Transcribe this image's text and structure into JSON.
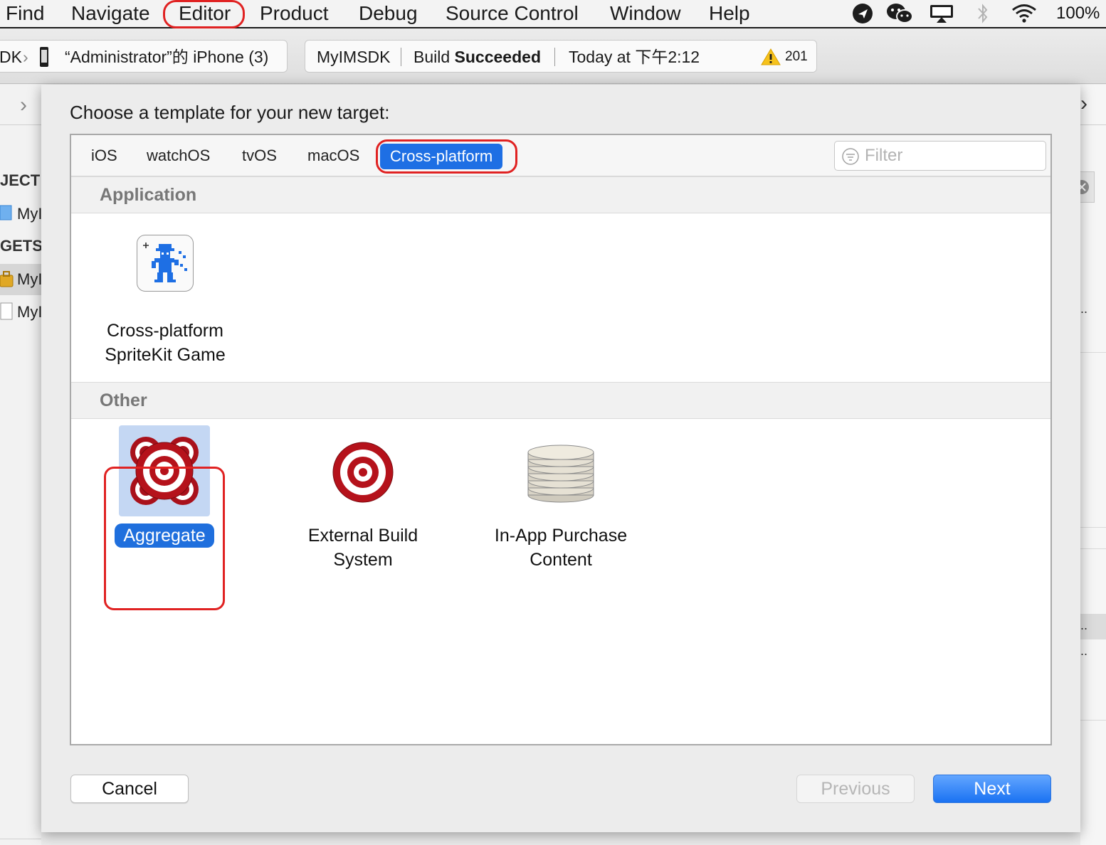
{
  "menubar": {
    "items": [
      "Find",
      "Navigate",
      "Editor",
      "Product",
      "Debug",
      "Source Control",
      "Window",
      "Help"
    ],
    "highlighted": "Editor",
    "status_icons": [
      "lark-icon",
      "wechat-icon",
      "airplay-icon",
      "bluetooth-icon",
      "wifi-icon"
    ],
    "battery": "100%"
  },
  "toolbar": {
    "scheme_left": "DK",
    "device": "“Administrator”的 iPhone (3)",
    "project": "MyIMSDK",
    "build_prefix": "Build ",
    "build_status": "Succeeded",
    "time": "Today at 下午2:12",
    "warnings": "201"
  },
  "navigator": {
    "project_header": "JECT",
    "project_item": "MyI",
    "targets_header": "GETS",
    "target_items": [
      "MyI",
      "MyI"
    ]
  },
  "dialog": {
    "title": "Choose a template for your new target:",
    "tabs": [
      "iOS",
      "watchOS",
      "tvOS",
      "macOS",
      "Cross-platform"
    ],
    "active_tab": "Cross-platform",
    "filter_placeholder": "Filter",
    "sections": [
      {
        "title": "Application",
        "templates": [
          {
            "line1": "Cross-platform",
            "line2": "SpriteKit Game",
            "icon": "spritekit-game-icon"
          }
        ]
      },
      {
        "title": "Other",
        "templates": [
          {
            "line1": "Aggregate",
            "line2": "",
            "icon": "aggregate-icon",
            "selected": true
          },
          {
            "line1": "External Build",
            "line2": "System",
            "icon": "external-build-icon"
          },
          {
            "line1": "In-App Purchase",
            "line2": "Content",
            "icon": "coins-icon"
          }
        ]
      }
    ],
    "buttons": {
      "cancel": "Cancel",
      "previous": "Previous",
      "next": "Next"
    }
  },
  "colors": {
    "accent": "#1f6fdd",
    "annotation": "#e02222",
    "target_red": "#b5121b"
  }
}
